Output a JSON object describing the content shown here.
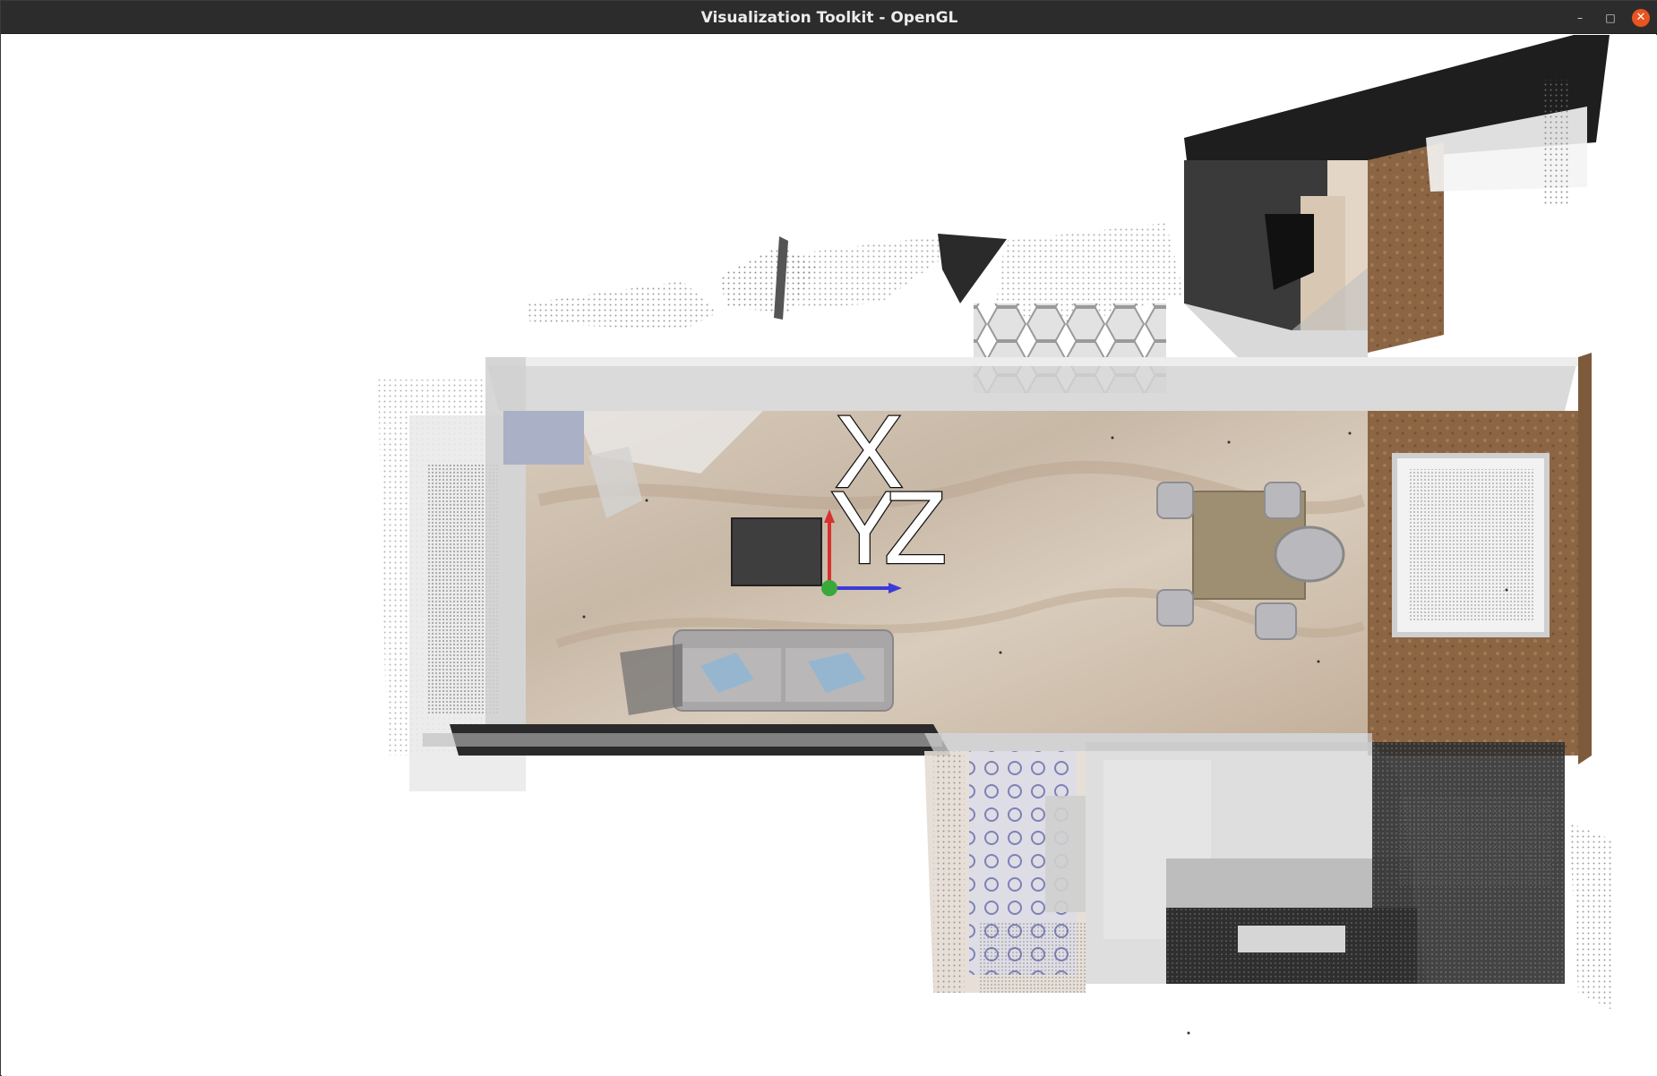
{
  "window": {
    "title": "Visualization Toolkit - OpenGL",
    "controls": {
      "minimize": "–",
      "maximize": "□",
      "close": "✕"
    }
  },
  "scene": {
    "axis_labels": {
      "x": "X",
      "y": "Y",
      "z": "Z"
    },
    "axis_colors": {
      "x": "#d93030",
      "y": "#3aa83a",
      "z": "#3b3bd9"
    },
    "colors": {
      "floor_marble": "#cdbfae",
      "wall_glass": "#d4d4d4",
      "wood_panel": "#8b6544",
      "dark_tile": "#2e2e2e",
      "sofa": "#a9a6a8",
      "table_wood": "#9e8f73",
      "bath_tile": "#8b8fb8",
      "points": "#7a7a7a"
    }
  }
}
